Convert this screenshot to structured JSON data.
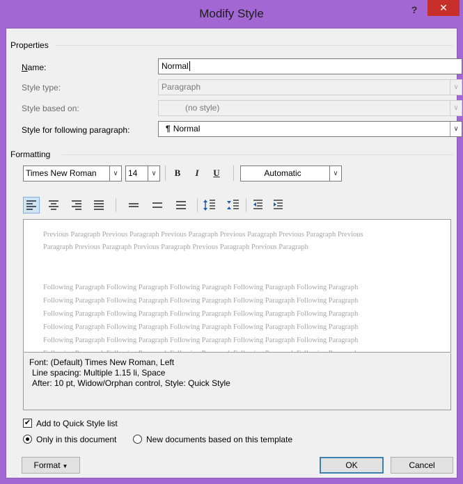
{
  "window": {
    "title": "Modify Style",
    "help_label": "?",
    "close_label": "✕"
  },
  "properties": {
    "section_label": "Properties",
    "name_label": "Name:",
    "name_value": "Normal",
    "style_type_label": "Style type:",
    "style_type_value": "Paragraph",
    "style_based_on_label": "Style based on:",
    "style_based_on_value": "(no style)",
    "following_label": "Style for following paragraph:",
    "following_value": "Normal",
    "following_icon": "¶"
  },
  "formatting": {
    "section_label": "Formatting",
    "font": "Times New Roman",
    "size": "14",
    "bold_label": "B",
    "italic_label": "I",
    "underline_label": "U",
    "color": "Automatic",
    "icons": {
      "align_left": "align-left-icon",
      "align_center": "align-center-icon",
      "align_right": "align-right-icon",
      "justify": "justify-icon",
      "single_spacing": "single-spacing-icon",
      "one_half_spacing": "one-half-spacing-icon",
      "double_spacing": "double-spacing-icon",
      "increase_spacing_before": "increase-spacing-before-icon",
      "decrease_spacing_before": "decrease-spacing-before-icon",
      "decrease_indent": "decrease-indent-icon",
      "increase_indent": "increase-indent-icon"
    }
  },
  "preview": {
    "previous_line1": "Previous Paragraph Previous Paragraph Previous Paragraph Previous Paragraph Previous Paragraph Previous",
    "previous_line2": "Paragraph Previous Paragraph Previous Paragraph Previous Paragraph Previous Paragraph",
    "following_line": "Following Paragraph Following Paragraph Following Paragraph Following Paragraph Following Paragraph"
  },
  "description": {
    "line1": "Font: (Default) Times New Roman, Left",
    "line2": "Line spacing:  Multiple 1.15 li, Space",
    "line3": "After:  10 pt, Widow/Orphan control, Style: Quick Style"
  },
  "options": {
    "add_quick_style_label": "Add to Quick Style list",
    "add_quick_style_checked": true,
    "only_this_doc_label": "Only in this document",
    "new_docs_label": "New documents based on this template"
  },
  "buttons": {
    "format_label": "Format",
    "ok_label": "OK",
    "cancel_label": "Cancel"
  },
  "colors": {
    "title_bar": "#a267d3",
    "close_button": "#c7302a",
    "dialog_bg": "#f0f0f0"
  }
}
